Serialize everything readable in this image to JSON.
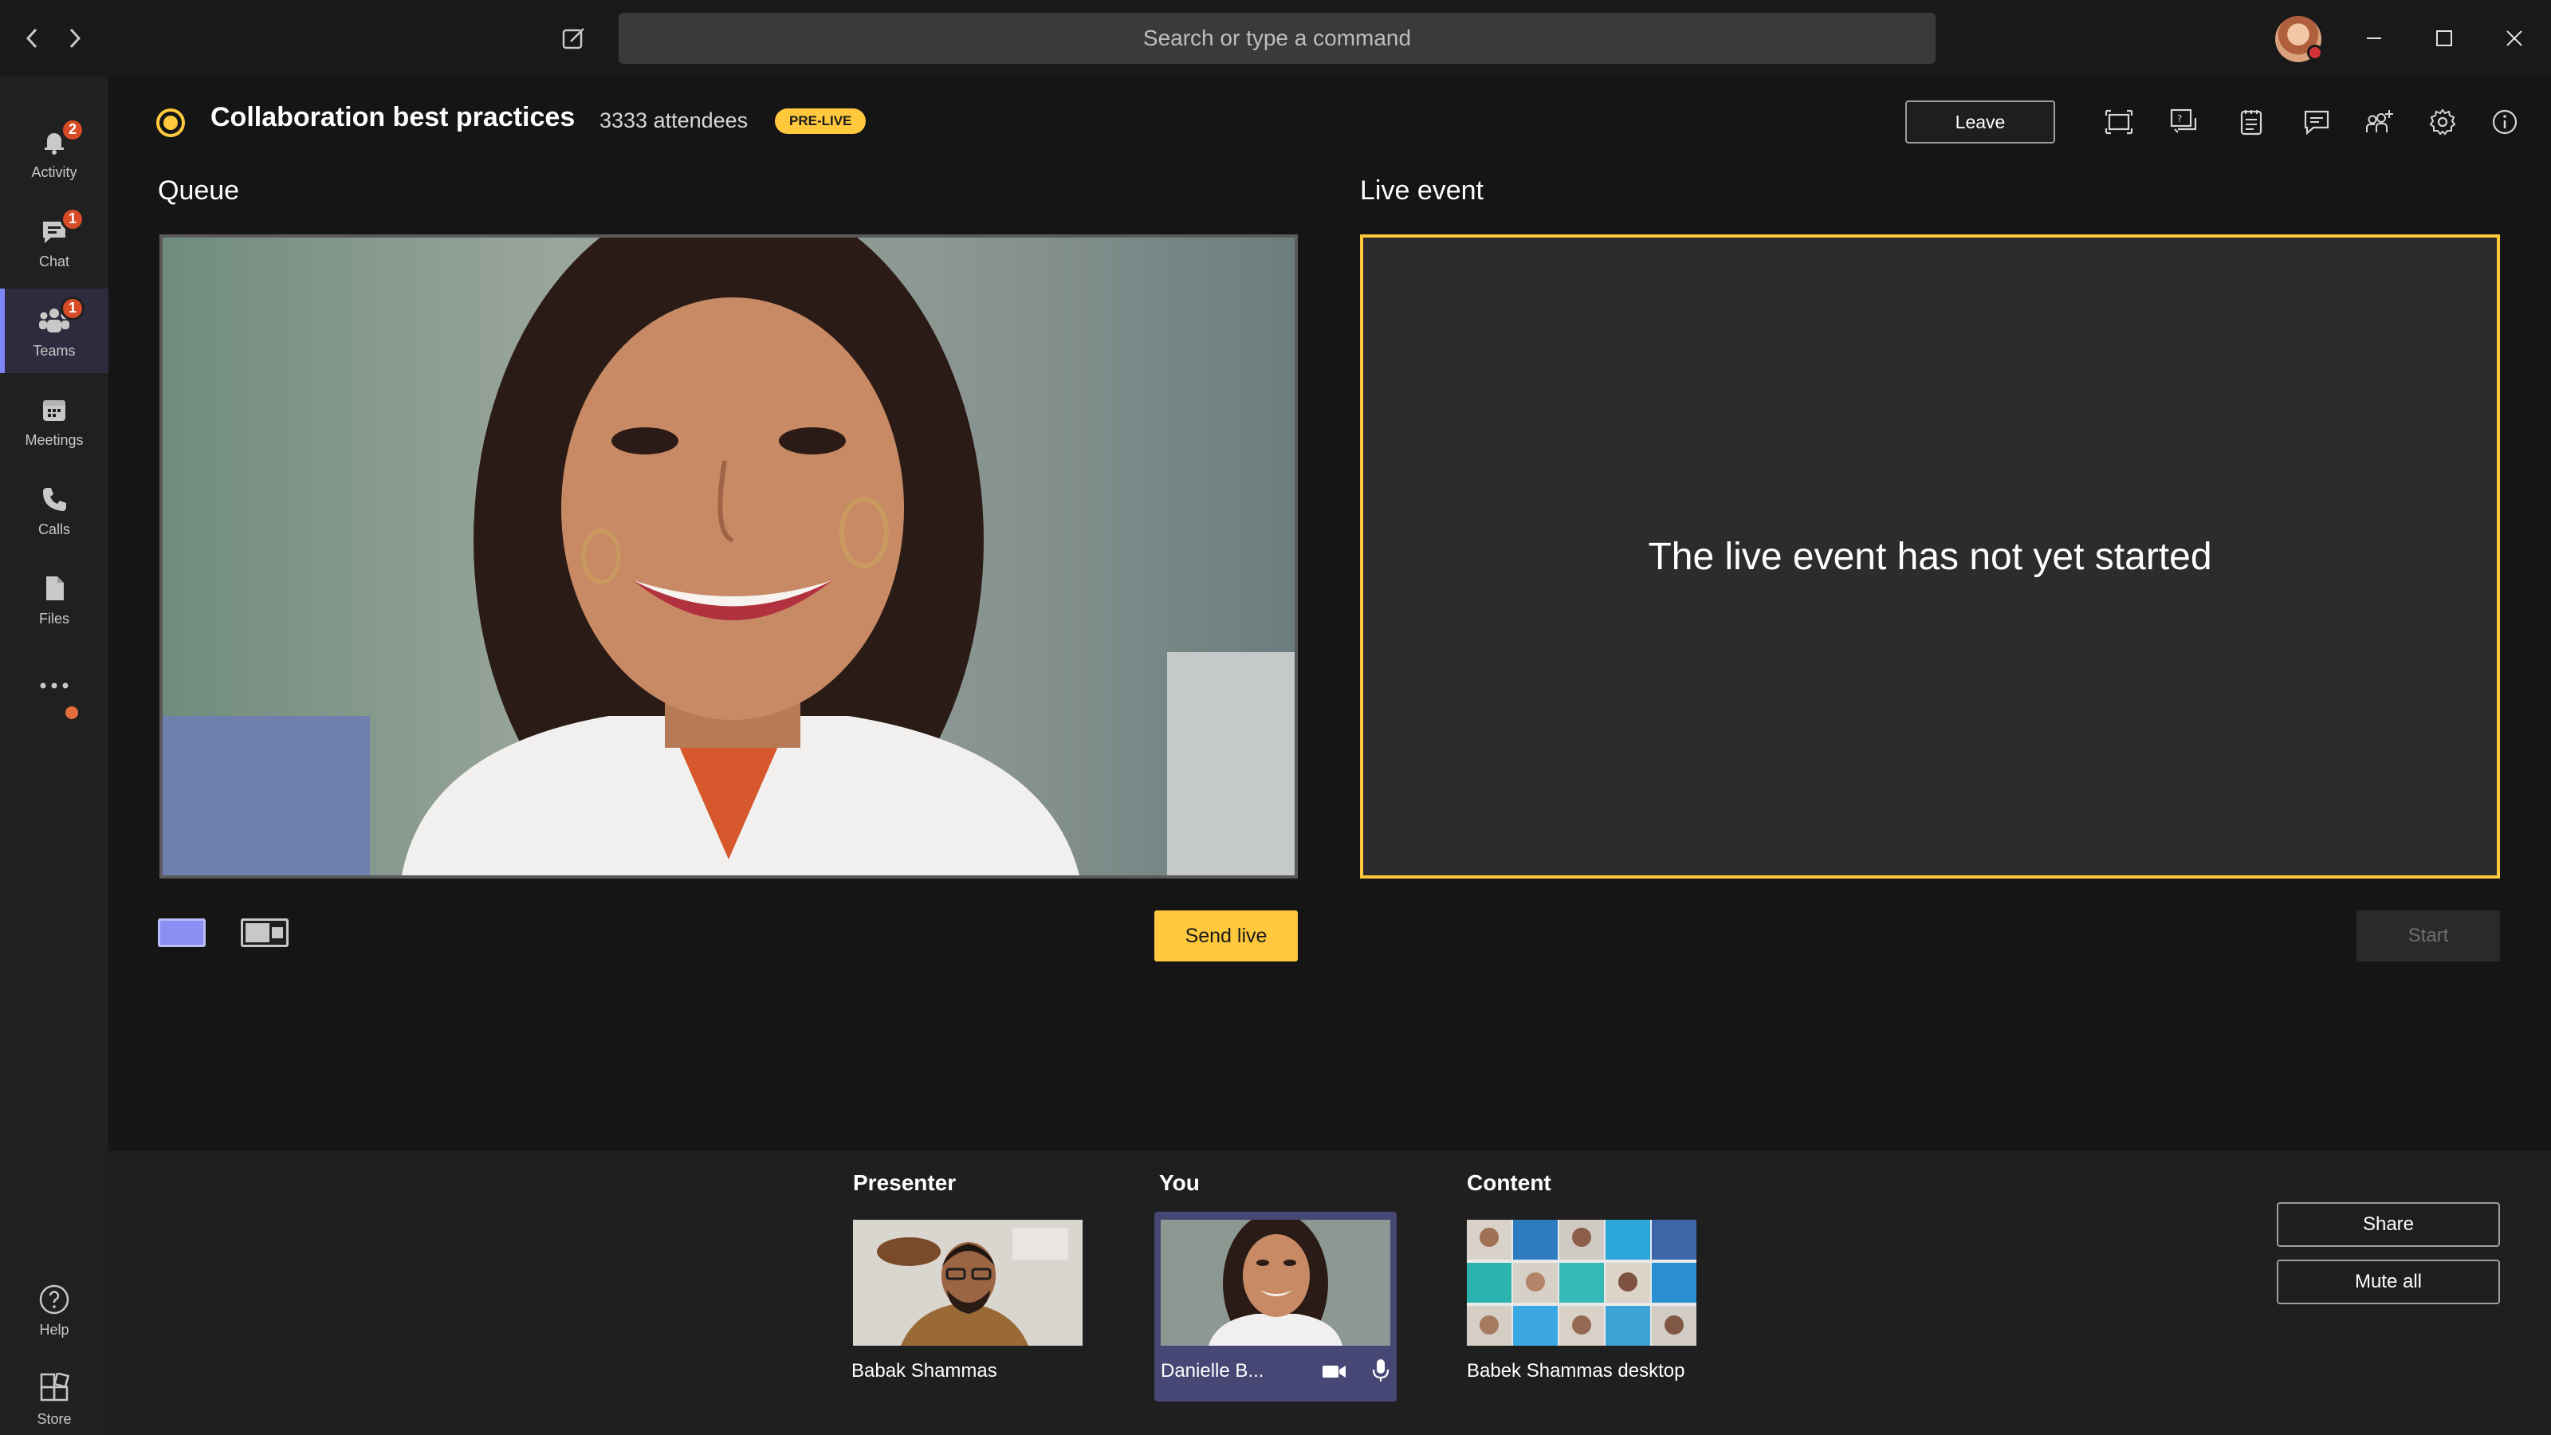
{
  "titlebar": {
    "search_placeholder": "Search or type a command"
  },
  "rail": {
    "items": [
      {
        "label": "Activity",
        "icon": "bell-icon",
        "badge": "2"
      },
      {
        "label": "Chat",
        "icon": "chat-icon",
        "badge": "1"
      },
      {
        "label": "Teams",
        "icon": "teams-icon",
        "badge": "1",
        "active": true
      },
      {
        "label": "Meetings",
        "icon": "calendar-icon"
      },
      {
        "label": "Calls",
        "icon": "phone-icon"
      },
      {
        "label": "Files",
        "icon": "file-icon"
      }
    ],
    "more_icon": "ellipsis-icon",
    "bottom": [
      {
        "label": "Help",
        "icon": "help-icon"
      },
      {
        "label": "Store",
        "icon": "store-icon"
      }
    ]
  },
  "header": {
    "title": "Collaboration best practices",
    "attendees": "3333 attendees",
    "status_badge": "PRE-LIVE",
    "leave_label": "Leave",
    "status_color": "#ffc83d"
  },
  "queue": {
    "label": "Queue",
    "send_live_label": "Send live"
  },
  "live_event": {
    "label": "Live event",
    "message": "The live event has not yet started",
    "start_label": "Start"
  },
  "tray": {
    "presenter": {
      "label": "Presenter",
      "name": "Babak Shammas"
    },
    "you": {
      "label": "You",
      "name": "Danielle B..."
    },
    "content": {
      "label": "Content",
      "name": "Babek Shammas desktop"
    },
    "share_label": "Share",
    "mute_all_label": "Mute all"
  },
  "colors": {
    "accent": "#ffc83d",
    "rail_active": "#7f85f5",
    "you_card": "#464775",
    "badge": "#d74b26"
  }
}
